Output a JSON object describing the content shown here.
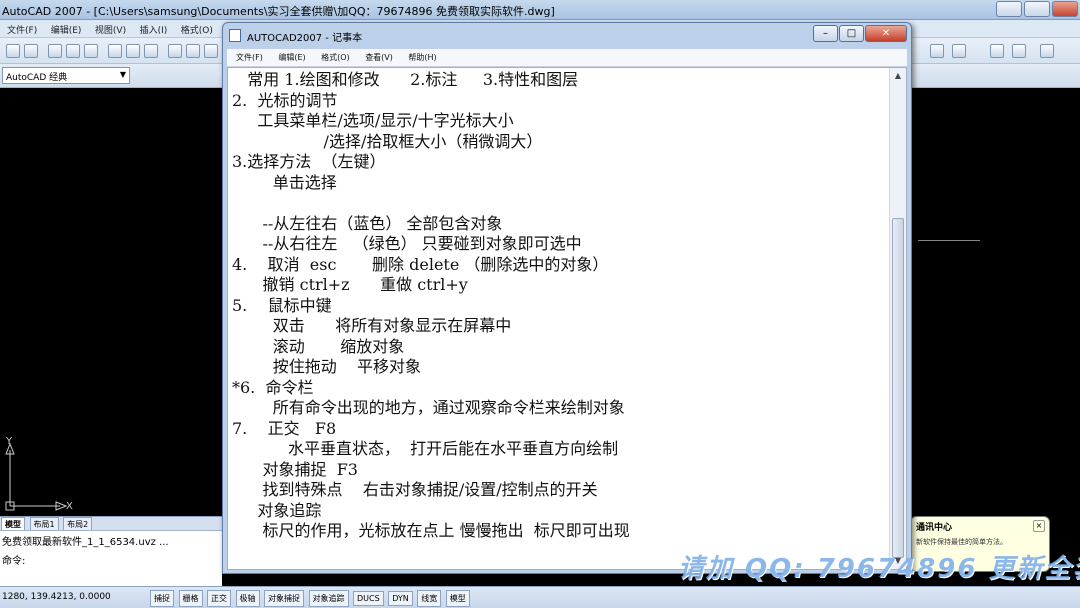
{
  "acad": {
    "title": "AutoCAD 2007 - [C:\\Users\\samsung\\Documents\\实习全套供赠\\加QQ：79674896 免费领取实际软件.dwg]",
    "menu": [
      "文件(F)",
      "编辑(E)",
      "视图(V)",
      "插入(I)",
      "格式(O)"
    ],
    "workspace": "AutoCAD 经典",
    "tabs": [
      "模型",
      "布局1",
      "布局2"
    ],
    "cmd_lines": [
      "免费领取最新软件_1_1_6534.uvz ...",
      "命令:"
    ],
    "coords": "1280, 139.4213, 0.0000",
    "status_buttons": [
      "捕捉",
      "栅格",
      "正交",
      "极轴",
      "对象捕捉",
      "对象追踪",
      "DUCS",
      "DYN",
      "线宽",
      "模型"
    ],
    "ucs_x": "X",
    "ucs_y": "Y"
  },
  "notify": {
    "title": "通讯中心",
    "body": "新软件保持最佳的简单方法。"
  },
  "watermark": "请加 QQ: 79674896 更新全套",
  "notepad": {
    "title": "AUTOCAD2007 - 记事本",
    "menu": [
      "文件(F)",
      "编辑(E)",
      "格式(O)",
      "查看(V)",
      "帮助(H)"
    ],
    "lines": [
      "   常用 1.绘图和修改      2.标注     3.特性和图层",
      "2.  光标的调节",
      "     工具菜单栏/选项/显示/十字光标大小",
      "                  /选择/拾取框大小（稍微调大）",
      "3.选择方法  （左键）",
      "        单击选择",
      "",
      "      --从左往右（蓝色） 全部包含对象",
      "      --从右往左   （绿色） 只要碰到对象即可选中",
      "4.    取消  esc       删除 delete （删除选中的对象）",
      "      撤销 ctrl+z      重做 ctrl+y",
      "5.    鼠标中键",
      "        双击      将所有对象显示在屏幕中",
      "        滚动       缩放对象",
      "        按住拖动    平移对象",
      "*6.  命令栏",
      "        所有命令出现的地方，通过观察命令栏来绘制对象",
      "7.    正交   F8",
      "           水平垂直状态，  打开后能在水平垂直方向绘制",
      "      对象捕捉  F3",
      "      找到特殊点    右击对象捕捉/设置/控制点的开关",
      "     对象追踪",
      "      标尺的作用，光标放在点上 慢慢拖出  标尺即可出现"
    ]
  },
  "colors": {
    "drawing_bg": "#000000",
    "window_frame": "#bcd0ea",
    "watermark": "#78aae6"
  }
}
